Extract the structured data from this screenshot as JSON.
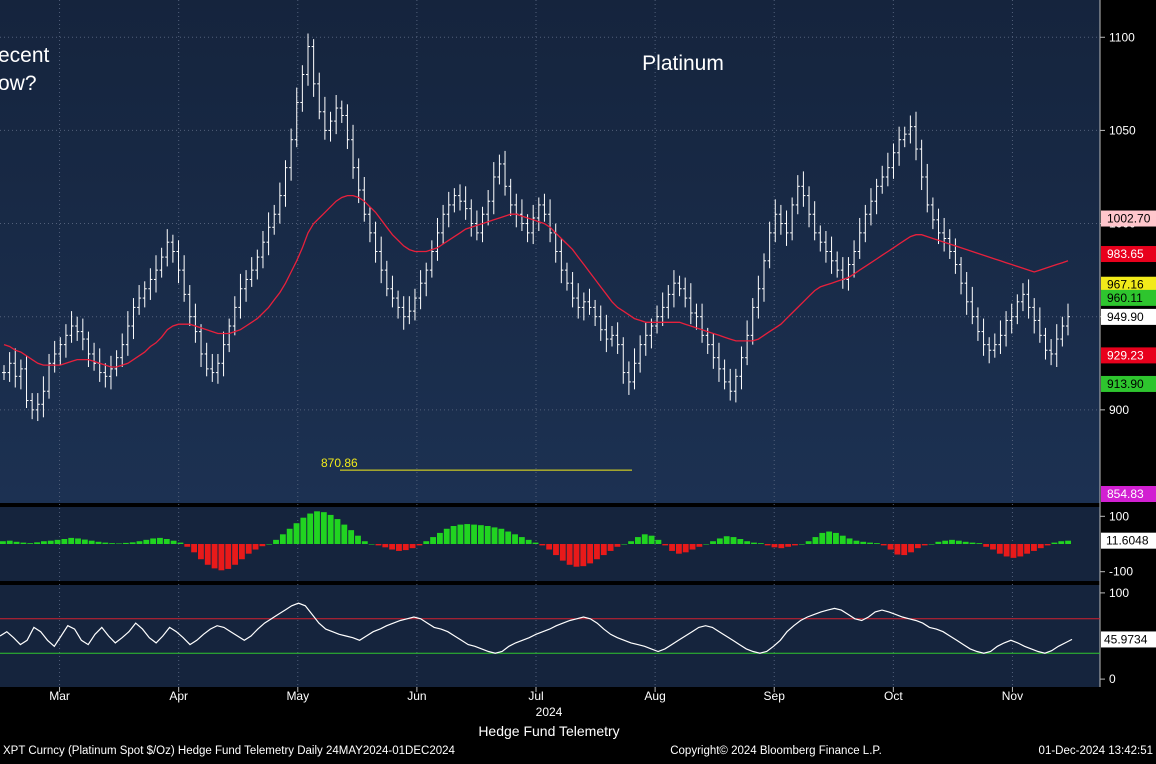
{
  "chart_data": {
    "type": "line",
    "title": "Platinum",
    "overlay_text": [
      "ecent",
      "ow?"
    ],
    "xlabel": "Hedge Fund Telemetry",
    "x_months": [
      "Mar",
      "Apr",
      "May",
      "Jun",
      "Jul",
      "Aug",
      "Sep",
      "Oct",
      "Nov"
    ],
    "x_year": "2024",
    "footer": {
      "left": "XPT Curncy (Platinum Spot  $/Oz) Hedge Fund Telemetry  Daily 24MAY2024-01DEC2024",
      "center": "Copyright© 2024 Bloomberg Finance L.P.",
      "right": "01-Dec-2024 13:42:51"
    },
    "price_panel": {
      "ylim": [
        850,
        1120
      ],
      "yticks": [
        900,
        950,
        1000,
        1050,
        1100
      ],
      "ytick_labels": [
        "900",
        "950",
        "1000",
        "1050",
        "1100"
      ],
      "price_labels": [
        {
          "text": "1002.70",
          "value": 1002.7,
          "fill": "#ffc6cc",
          "color": "#000000"
        },
        {
          "text": "983.65",
          "value": 983.65,
          "fill": "#e8001c",
          "color": "#ffffff"
        },
        {
          "text": "967.16",
          "value": 967.16,
          "fill": "#f2ea1a",
          "color": "#000000"
        },
        {
          "text": "960.11",
          "value": 960.11,
          "fill": "#2ec52e",
          "color": "#000000"
        },
        {
          "text": "949.90",
          "value": 949.9,
          "fill": "#ffffff",
          "color": "#000000"
        },
        {
          "text": "929.23",
          "value": 929.23,
          "fill": "#e8001c",
          "color": "#ffffff"
        },
        {
          "text": "913.90",
          "value": 913.9,
          "fill": "#2ec52e",
          "color": "#000000"
        },
        {
          "text": "854.83",
          "value": 854.83,
          "fill": "#d21fd2",
          "color": "#ffffff"
        }
      ],
      "annotation": {
        "text": "870.86",
        "value": 870.86
      },
      "series": [
        {
          "name": "",
          "color": "#ffffff",
          "values": [
            920,
            925,
            918,
            922,
            905,
            900,
            903,
            910,
            925,
            930,
            935,
            940,
            945,
            942,
            938,
            930,
            925,
            920,
            918,
            922,
            928,
            935,
            945,
            955,
            960,
            965,
            970,
            975,
            982,
            990,
            985,
            975,
            962,
            950,
            942,
            930,
            922,
            920,
            925,
            935,
            945,
            955,
            965,
            970,
            975,
            982,
            990,
            998,
            1005,
            1015,
            1030,
            1045,
            1065,
            1080,
            1095,
            1075,
            1060,
            1050,
            1055,
            1062,
            1058,
            1045,
            1030,
            1018,
            1005,
            995,
            985,
            975,
            965,
            960,
            955,
            950,
            953,
            960,
            968,
            975,
            985,
            995,
            1005,
            1010,
            1015,
            1012,
            1008,
            1000,
            995,
            1005,
            1012,
            1025,
            1032,
            1020,
            1010,
            1005,
            1000,
            995,
            1003,
            1010,
            1005,
            995,
            985,
            975,
            968,
            960,
            955,
            958,
            955,
            950,
            943,
            938,
            940,
            935,
            920,
            915,
            925,
            935,
            940,
            945,
            950,
            955,
            962,
            968,
            965,
            960,
            952,
            950,
            940,
            935,
            928,
            922,
            915,
            910,
            918,
            928,
            940,
            955,
            965,
            980,
            995,
            1005,
            1000,
            995,
            1010,
            1020,
            1015,
            1005,
            995,
            990,
            985,
            980,
            975,
            970,
            978,
            985,
            995,
            1005,
            1012,
            1020,
            1025,
            1030,
            1038,
            1045,
            1048,
            1052,
            1040,
            1025,
            1010,
            1002,
            995,
            992,
            985,
            978,
            968,
            958,
            950,
            942,
            935,
            932,
            935,
            940,
            948,
            950,
            958,
            962,
            955,
            948,
            940,
            932,
            930,
            938,
            945,
            950
          ]
        },
        {
          "name": "",
          "color": "#e8203c",
          "values": [
            935,
            934,
            932,
            931,
            929,
            927,
            925,
            924,
            924,
            924,
            924,
            925,
            926,
            927,
            927,
            927,
            926,
            925,
            924,
            923,
            923,
            924,
            925,
            927,
            929,
            931,
            934,
            936,
            939,
            943,
            945,
            946,
            946,
            946,
            945,
            944,
            943,
            942,
            941,
            941,
            941,
            942,
            943,
            945,
            947,
            949,
            952,
            955,
            959,
            963,
            968,
            974,
            980,
            987,
            995,
            1000,
            1003,
            1006,
            1009,
            1012,
            1014,
            1015,
            1015,
            1014,
            1012,
            1009,
            1006,
            1002,
            998,
            994,
            991,
            988,
            986,
            985,
            985,
            985,
            986,
            987,
            989,
            991,
            993,
            995,
            997,
            998,
            999,
            1000,
            1001,
            1002,
            1003,
            1004,
            1005,
            1005,
            1004,
            1003,
            1002,
            1001,
            1000,
            998,
            995,
            992,
            989,
            986,
            982,
            978,
            974,
            970,
            966,
            962,
            958,
            955,
            953,
            951,
            949,
            948,
            947,
            947,
            947,
            947,
            947,
            947,
            947,
            946,
            945,
            944,
            943,
            942,
            941,
            940,
            939,
            938,
            937,
            937,
            937,
            937,
            938,
            940,
            942,
            944,
            946,
            949,
            952,
            955,
            958,
            961,
            964,
            966,
            967,
            968,
            969,
            970,
            971,
            973,
            975,
            977,
            979,
            981,
            983,
            985,
            987,
            989,
            991,
            993,
            994,
            994,
            993,
            992,
            991,
            990,
            989,
            988,
            987,
            986,
            985,
            984,
            983,
            982,
            981,
            980,
            979,
            978,
            977,
            976,
            975,
            974,
            975,
            976,
            977,
            978,
            979,
            980
          ]
        }
      ]
    },
    "macd_panel": {
      "ylim": [
        -130,
        130
      ],
      "yticks": [
        100,
        -100
      ],
      "ytick_labels": [
        "100",
        "-100"
      ],
      "last_value": "11.6048",
      "values": [
        10,
        12,
        8,
        5,
        3,
        6,
        10,
        12,
        15,
        18,
        22,
        20,
        16,
        12,
        8,
        5,
        3,
        2,
        4,
        6,
        10,
        15,
        20,
        22,
        18,
        12,
        5,
        -10,
        -30,
        -55,
        -75,
        -88,
        -95,
        -90,
        -75,
        -55,
        -35,
        -20,
        -8,
        0,
        15,
        35,
        55,
        75,
        95,
        110,
        118,
        115,
        105,
        90,
        70,
        50,
        30,
        10,
        0,
        -5,
        -12,
        -20,
        -25,
        -22,
        -15,
        -5,
        10,
        25,
        40,
        55,
        65,
        70,
        72,
        70,
        68,
        65,
        60,
        55,
        45,
        35,
        25,
        15,
        5,
        -5,
        -20,
        -40,
        -60,
        -75,
        -82,
        -80,
        -70,
        -55,
        -40,
        -25,
        -10,
        0,
        10,
        25,
        35,
        30,
        15,
        -5,
        -25,
        -35,
        -30,
        -20,
        -10,
        0,
        10,
        20,
        28,
        25,
        18,
        10,
        5,
        3,
        -5,
        -12,
        -15,
        -10,
        -5,
        0,
        10,
        25,
        40,
        45,
        40,
        30,
        20,
        12,
        8,
        5,
        3,
        -5,
        -20,
        -38,
        -40,
        -30,
        -15,
        -5,
        0,
        8,
        12,
        15,
        12,
        8,
        5,
        3,
        -10,
        -20,
        -35,
        -45,
        -50,
        -45,
        -35,
        -25,
        -15,
        -5,
        5,
        10,
        12
      ]
    },
    "stoch_panel": {
      "ylim": [
        -8,
        108
      ],
      "yticks": [
        100,
        0
      ],
      "ytick_labels": [
        "100",
        "0"
      ],
      "upper_band": 70,
      "lower_band": 30,
      "last_value": "45.9734",
      "values": [
        50,
        55,
        48,
        40,
        45,
        60,
        55,
        45,
        38,
        50,
        62,
        58,
        45,
        40,
        52,
        60,
        50,
        42,
        48,
        55,
        65,
        58,
        48,
        42,
        50,
        60,
        55,
        48,
        40,
        45,
        52,
        58,
        62,
        60,
        55,
        50,
        45,
        50,
        58,
        65,
        70,
        75,
        80,
        85,
        88,
        85,
        75,
        65,
        58,
        55,
        52,
        50,
        48,
        45,
        50,
        55,
        58,
        62,
        65,
        68,
        70,
        72,
        70,
        65,
        60,
        58,
        55,
        50,
        45,
        40,
        38,
        35,
        32,
        30,
        32,
        38,
        42,
        45,
        48,
        52,
        55,
        58,
        62,
        65,
        68,
        70,
        72,
        70,
        65,
        58,
        52,
        48,
        45,
        42,
        40,
        38,
        35,
        32,
        35,
        40,
        45,
        50,
        55,
        60,
        62,
        60,
        55,
        50,
        45,
        40,
        35,
        32,
        30,
        32,
        38,
        45,
        55,
        62,
        68,
        72,
        75,
        78,
        80,
        82,
        80,
        75,
        70,
        68,
        72,
        78,
        80,
        78,
        75,
        72,
        70,
        68,
        65,
        60,
        58,
        55,
        50,
        45,
        40,
        35,
        32,
        30,
        32,
        38,
        42,
        45,
        42,
        38,
        35,
        32,
        30,
        33,
        38,
        42,
        46
      ]
    }
  }
}
